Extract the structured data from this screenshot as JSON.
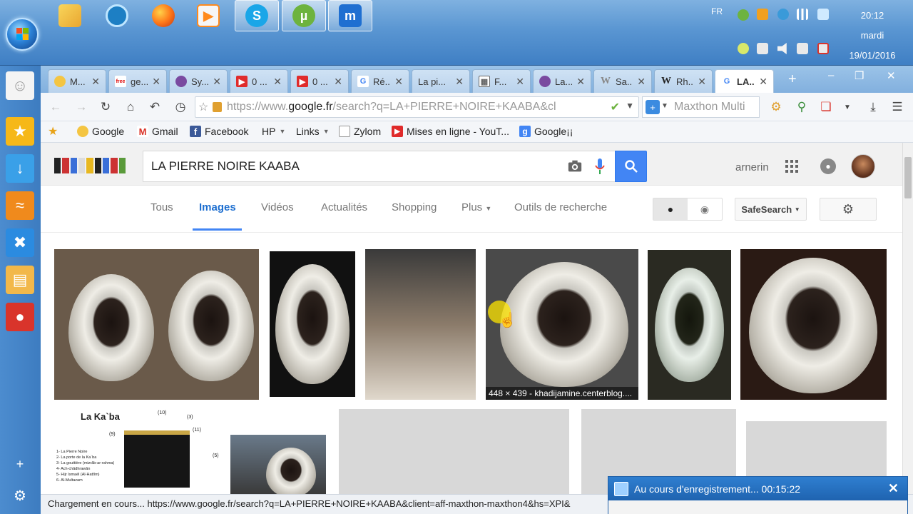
{
  "taskbar": {
    "apps": [
      {
        "name": "windows-explorer",
        "icon": "folder-icon"
      },
      {
        "name": "target-app",
        "icon": "target-icon"
      },
      {
        "name": "firefox",
        "icon": "firefox-icon"
      },
      {
        "name": "media-player",
        "icon": "play-icon"
      },
      {
        "name": "skype",
        "icon": "skype-icon",
        "glyph": "S"
      },
      {
        "name": "utorrent",
        "icon": "utorrent-icon",
        "glyph": "µ"
      },
      {
        "name": "maxthon",
        "icon": "maxthon-icon",
        "glyph": "m"
      }
    ],
    "language": "FR",
    "clock": {
      "time": "20:12",
      "day": "mardi",
      "date": "19/01/2016"
    }
  },
  "tabs": [
    {
      "title": "M...",
      "favicon_color": "#f4c542"
    },
    {
      "title": "ge...",
      "favicon_color": "#ffffff"
    },
    {
      "title": "Sy...",
      "favicon_color": "#7a4aa0"
    },
    {
      "title": "0 ...",
      "favicon_color": "#e02b2b"
    },
    {
      "title": "0 ...",
      "favicon_color": "#e02b2b"
    },
    {
      "title": "Ré...",
      "favicon_color": "#4285f4",
      "glyph": "G"
    },
    {
      "title": "La pi..."
    },
    {
      "title": "F...",
      "favicon_color": "#666666"
    },
    {
      "title": "La...",
      "favicon_color": "#7a4aa0"
    },
    {
      "title": "Sa...",
      "favicon_color": "#888888",
      "glyph": "W"
    },
    {
      "title": "Rh...",
      "favicon_color": "#222222",
      "glyph": "W"
    },
    {
      "title": "LA...",
      "favicon_color": "#4285f4",
      "glyph": "G",
      "active": true
    }
  ],
  "address": {
    "prefix": "https://www.",
    "domain": "google.fr",
    "rest": "/search?q=LA+PIERRE+NOIRE+KAABA&cl"
  },
  "search_engine": {
    "placeholder": "Maxthon Multi"
  },
  "bookmarks": [
    {
      "label": "Google",
      "icon": "sun-icon"
    },
    {
      "label": "Gmail",
      "icon": "gmail-icon",
      "glyph": "M"
    },
    {
      "label": "Facebook",
      "icon": "facebook-icon",
      "glyph": "f"
    },
    {
      "label": "HP",
      "dropdown": true
    },
    {
      "label": "Links",
      "dropdown": true
    },
    {
      "label": "Zylom",
      "icon": "page-icon"
    },
    {
      "label": "Mises en ligne - YouT...",
      "icon": "youtube-icon"
    },
    {
      "label": "Google¡¡",
      "icon": "google-icon",
      "glyph": "g"
    }
  ],
  "google": {
    "query": "LA PIERRE NOIRE KAABA",
    "user": "arnerin",
    "tabs": [
      "Tous",
      "Images",
      "Vidéos",
      "Actualités",
      "Shopping",
      "Plus",
      "Outils de recherche"
    ],
    "active_tab": "Images",
    "safesearch": "SafeSearch",
    "hover_caption": "448 × 439 - khadijamine.centerblog....",
    "kaaba_diagram": {
      "title": "La Ka`ba",
      "callouts": [
        "(10)",
        "(3)",
        "(11)",
        "(9)",
        "(5)"
      ],
      "legend": [
        "1- La Pierre Noire",
        "2- La porte de la Ka`ba",
        "3- La gouttière (mizrâb-ar-rahma)",
        "4- Ach-châdhrawân",
        "5- Hijr Ismaël (Al-Hattîm)",
        "6- Al-Multazam"
      ]
    }
  },
  "status": "Chargement en cours... https://www.google.fr/search?q=LA+PIERRE+NOIRE+KAABA&client=aff-maxthon-maxthon4&hs=XPI&",
  "recorder": {
    "text": "Au cours d'enregistrement... 00:15:22"
  }
}
